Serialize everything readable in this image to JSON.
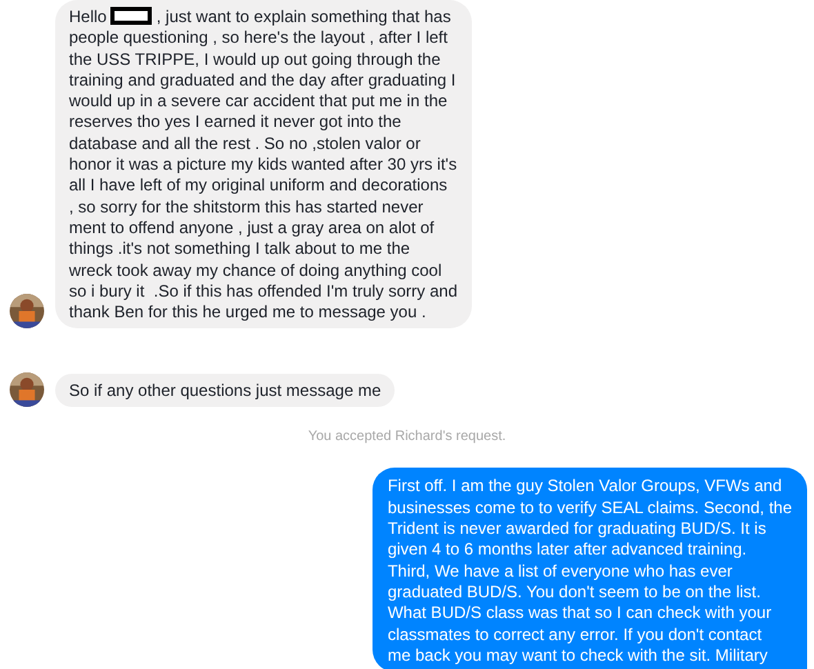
{
  "messages": [
    {
      "kind": "incoming",
      "avatar": true,
      "redacted_after": "Hello",
      "lines": [
        ", just want to explain something that has",
        "people questioning , so here's the layout , after I left",
        "the USS TRIPPE, I would up out going through the",
        "training and graduated and the day after graduating I",
        "would up in a severe car accident that put me in the",
        "reserves tho yes I earned it never got into the",
        "database and all the rest . So no ,stolen valor or",
        "honor it was a picture my kids wanted after 30 yrs it's",
        "all I have left of my original uniform and decorations",
        ", so sorry for the shitstorm this has started never",
        "ment to offend anyone , just a gray area on alot of",
        "things .it's not something I talk about to me the",
        "wreck took away my chance of doing anything cool",
        "so i bury it  .So if this has offended I'm truly sorry and",
        "thank Ben for this he urged me to message you ."
      ]
    },
    {
      "kind": "incoming",
      "avatar": true,
      "lines": [
        "So if any other questions just message me"
      ]
    },
    {
      "kind": "system",
      "lines": [
        "You accepted Richard's request."
      ]
    },
    {
      "kind": "outgoing",
      "lines": [
        "First off. I am the guy Stolen Valor Groups, VFWs and",
        "businesses come to to verify SEAL claims. Second, the",
        "Trident is never awarded for graduating BUD/S. It is",
        "given 4 to 6 months later after advanced training.",
        "Third, We have a list of everyone who has ever",
        "graduated BUD/S. You don't seem to be on the list.",
        "What BUD/S class was that so I can check with your",
        "classmates to correct any error. If you don't contact",
        "me back you may want to check with the sit. Military"
      ]
    }
  ]
}
